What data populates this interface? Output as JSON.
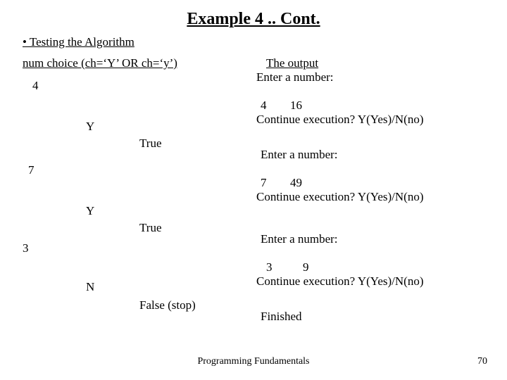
{
  "title": "Example 4 .. Cont.",
  "subheading": "• Testing the Algorithm",
  "columns": {
    "left_header": "num choice (ch=‘Y’ OR ch=‘y’)",
    "right_header": "The output"
  },
  "trace": {
    "num1": "4",
    "choice1": "Y",
    "cond1": "True",
    "num2": "7",
    "choice2": "Y",
    "cond2": "True",
    "num3": "3",
    "choice3": "N",
    "cond3": "False (stop)"
  },
  "output": {
    "l1": "Enter a number:",
    "l2a": "4",
    "l2b": "16",
    "l3": "Continue execution? Y(Yes)/N(no)",
    "l4": "Enter a number:",
    "l5a": "7",
    "l5b": "49",
    "l6": "Continue execution? Y(Yes)/N(no)",
    "l7": "Enter a number:",
    "l8a": "3",
    "l8b": "9",
    "l9": "Continue execution? Y(Yes)/N(no)",
    "l10": "Finished"
  },
  "footer": {
    "center": "Programming Fundamentals",
    "page": "70"
  }
}
